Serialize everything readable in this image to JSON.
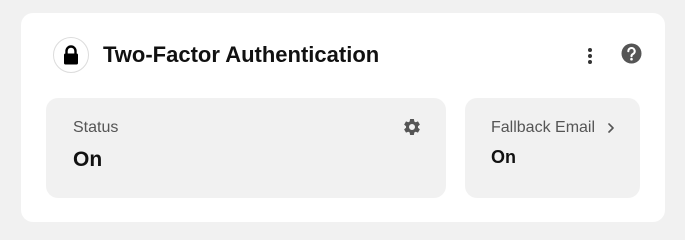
{
  "card": {
    "title": "Two-Factor Authentication",
    "icons": {
      "header": "lock-icon",
      "menu": "more-vertical-icon",
      "help": "help-circle-icon"
    }
  },
  "tiles": {
    "status": {
      "label": "Status",
      "value": "On",
      "icon": "gear-icon"
    },
    "fallback_email": {
      "label": "Fallback Email",
      "value": "On",
      "icon": "chevron-right-icon"
    }
  },
  "colors": {
    "page_background": "#f1f1f1",
    "card_background": "#ffffff",
    "tile_background": "#f1f1f1",
    "text_primary": "#111111",
    "text_secondary": "#555555",
    "icon": "#555555"
  }
}
